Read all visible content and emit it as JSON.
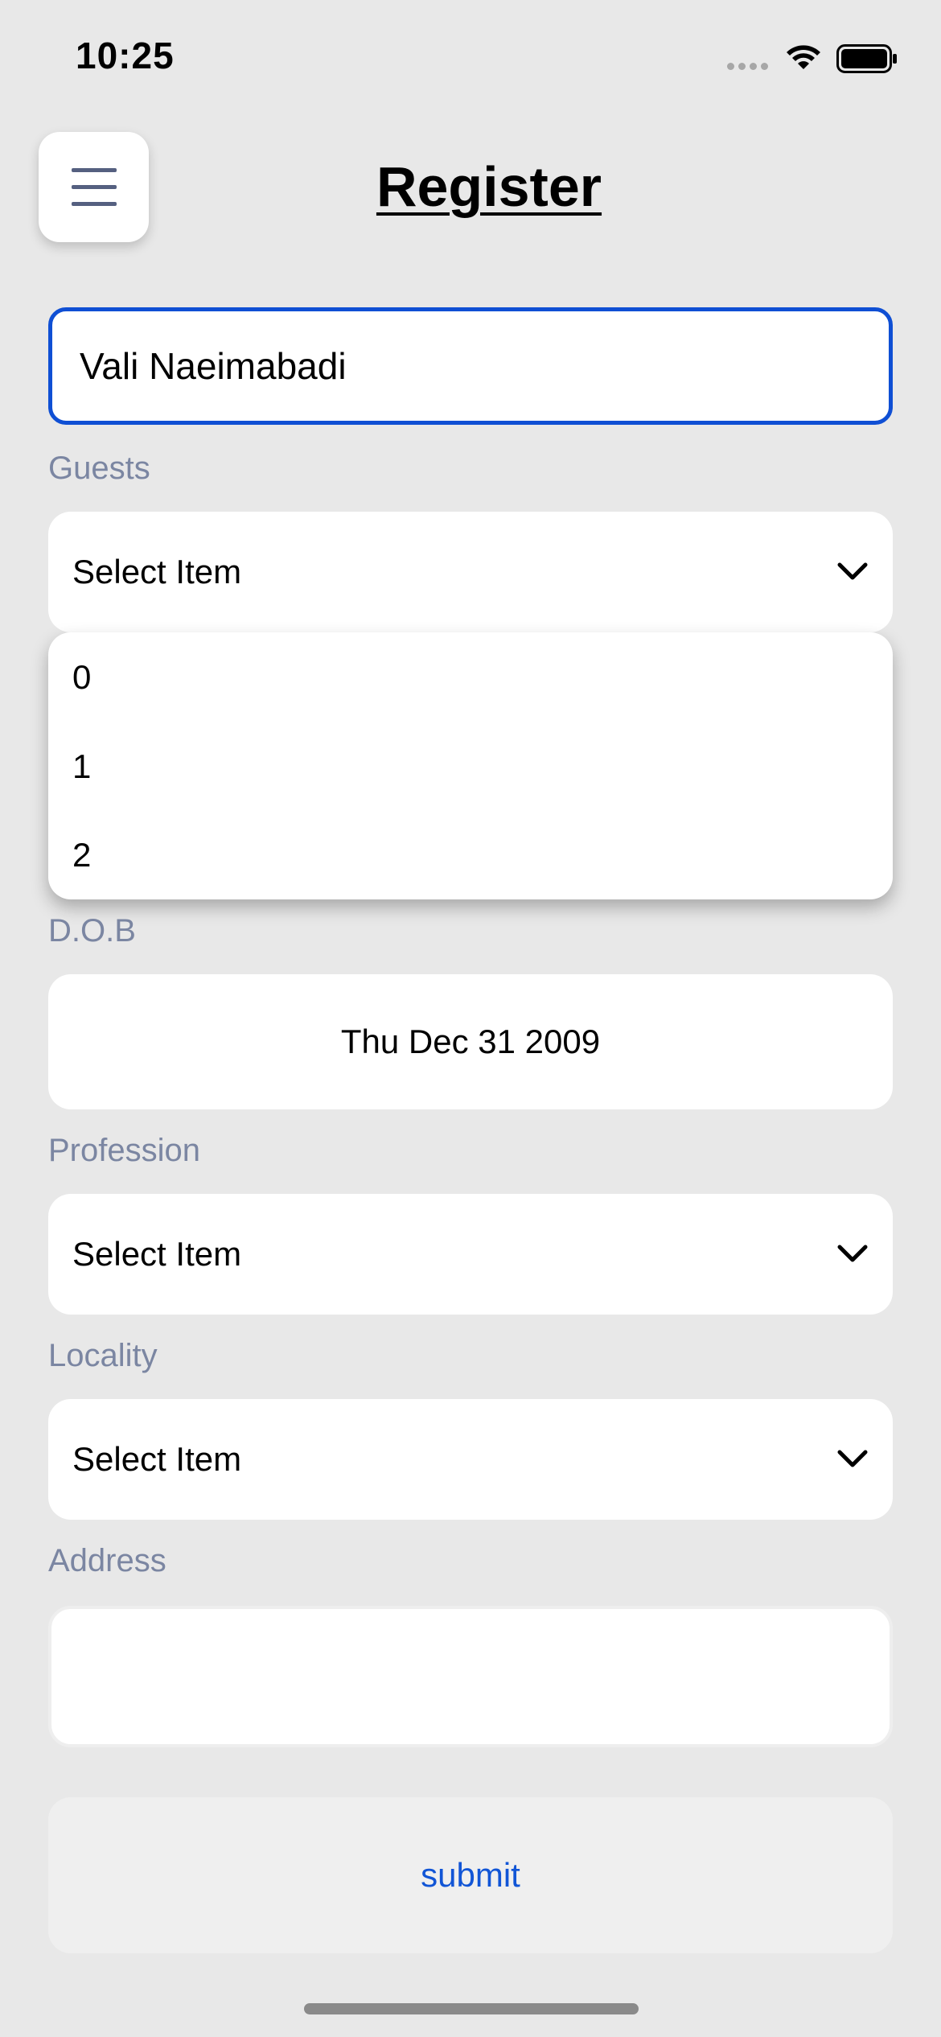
{
  "status_bar": {
    "time": "10:25"
  },
  "header": {
    "title": "Register",
    "menu_icon": "hamburger-menu-icon"
  },
  "form": {
    "name_value": "Vali Naeimabadi",
    "guests": {
      "label": "Guests",
      "value": "Select Item",
      "options": [
        "0",
        "1",
        "2"
      ]
    },
    "dob": {
      "label": "D.O.B",
      "value": "Thu Dec 31 2009"
    },
    "profession": {
      "label": "Profession",
      "value": "Select Item"
    },
    "locality": {
      "label": "Locality",
      "value": "Select Item"
    },
    "address": {
      "label": "Address",
      "value": ""
    },
    "submit_label": "submit"
  },
  "colors": {
    "background": "#e8e8e8",
    "focus_border": "#0f4fd4",
    "label_text": "#7b86a2",
    "submit_text": "#1155d6",
    "menu_bars": "#556080"
  }
}
